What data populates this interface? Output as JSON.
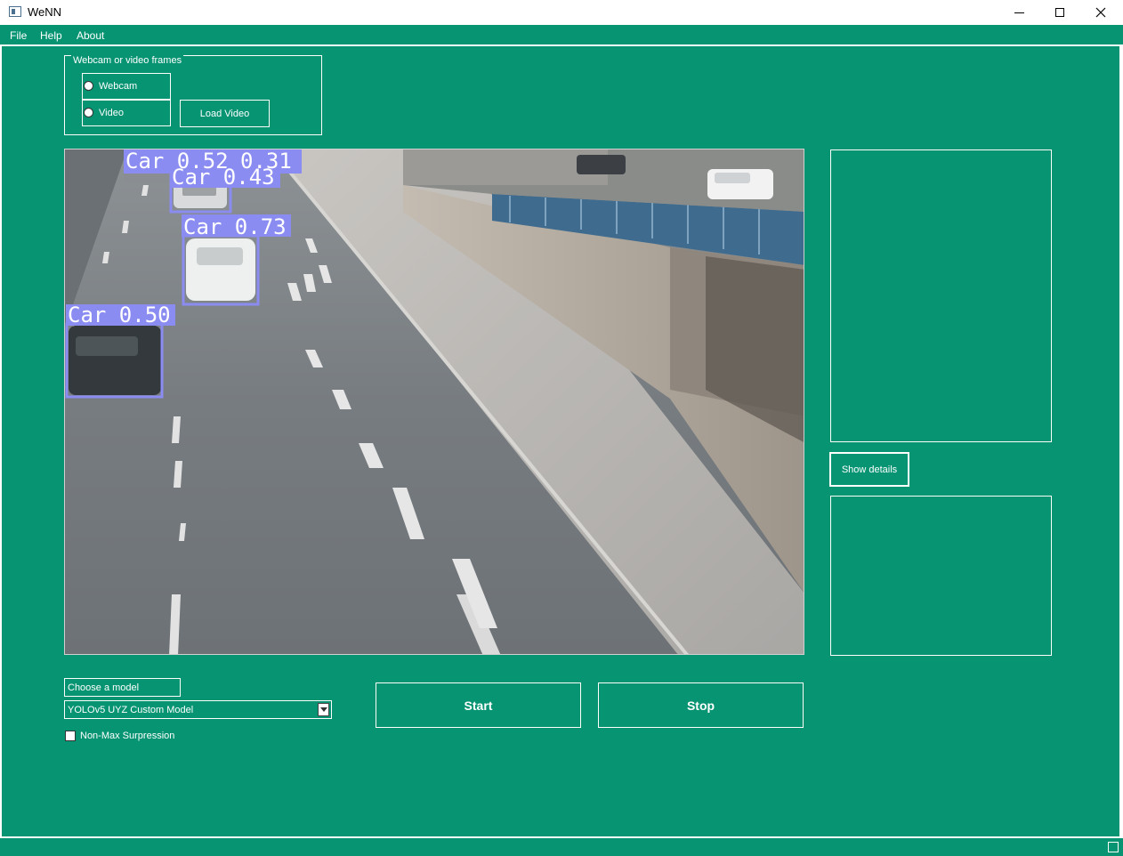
{
  "window": {
    "title": "WeNN"
  },
  "menu": {
    "items": [
      "File",
      "Help",
      "About"
    ]
  },
  "source_group": {
    "title": "Webcam or video frames",
    "webcam_label": "Webcam",
    "video_label": "Video",
    "load_video_label": "Load Video"
  },
  "detections": [
    {
      "label": "Car 0.52"
    },
    {
      "label": "0.31"
    },
    {
      "label": "Car 0.43"
    },
    {
      "label": "Car 0.73"
    },
    {
      "label": "Car 0.50"
    }
  ],
  "right_panel": {
    "show_details_label": "Show details"
  },
  "model": {
    "choose_label": "Choose a model",
    "selected": "YOLOv5 UYZ Custom Model",
    "nms_label": "Non-Max Surpression"
  },
  "controls": {
    "start_label": "Start",
    "stop_label": "Stop"
  },
  "colors": {
    "background": "#079472",
    "detection_box": "#8b8cf2"
  }
}
